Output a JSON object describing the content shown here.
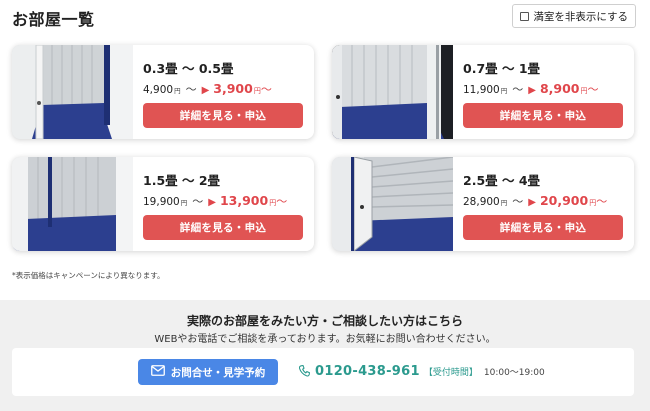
{
  "header": {
    "title": "お部屋一覧",
    "hide_full_label": "満室を非表示にする"
  },
  "rooms": [
    {
      "size": "0.3畳 〜 0.5畳",
      "regular_price": "4,900",
      "sale_price": "3,900",
      "yen": "円",
      "tilde": "〜",
      "button": "詳細を見る・申込"
    },
    {
      "size": "0.7畳 〜 1畳",
      "regular_price": "11,900",
      "sale_price": "8,900",
      "yen": "円",
      "tilde": "〜",
      "button": "詳細を見る・申込"
    },
    {
      "size": "1.5畳 〜 2畳",
      "regular_price": "19,900",
      "sale_price": "13,900",
      "yen": "円",
      "tilde": "〜",
      "button": "詳細を見る・申込"
    },
    {
      "size": "2.5畳 〜 4畳",
      "regular_price": "28,900",
      "sale_price": "20,900",
      "yen": "円",
      "tilde": "〜",
      "button": "詳細を見る・申込"
    }
  ],
  "note": "*表示価格はキャンペーンにより異なります。",
  "cta": {
    "title": "実際のお部屋をみたい方・ご相談したい方はこちら",
    "subtitle": "WEBやお電話でご相談を承っております。お気軽にお問い合わせください。",
    "contact_button": "お問合せ・見学予約",
    "phone": "0120-438-961",
    "hours_label": "【受付時間】",
    "hours": "10:00〜19:00"
  },
  "colors": {
    "accent_red": "#e05453",
    "sale_red": "#e0464b",
    "button_blue": "#4a87e6",
    "phone_teal": "#2b9a8e",
    "locker_blue": "#2c3f8f"
  },
  "icons": {
    "contact_button": "mail-icon",
    "phone": "phone-icon",
    "sale_arrow": "arrow-right-icon"
  }
}
